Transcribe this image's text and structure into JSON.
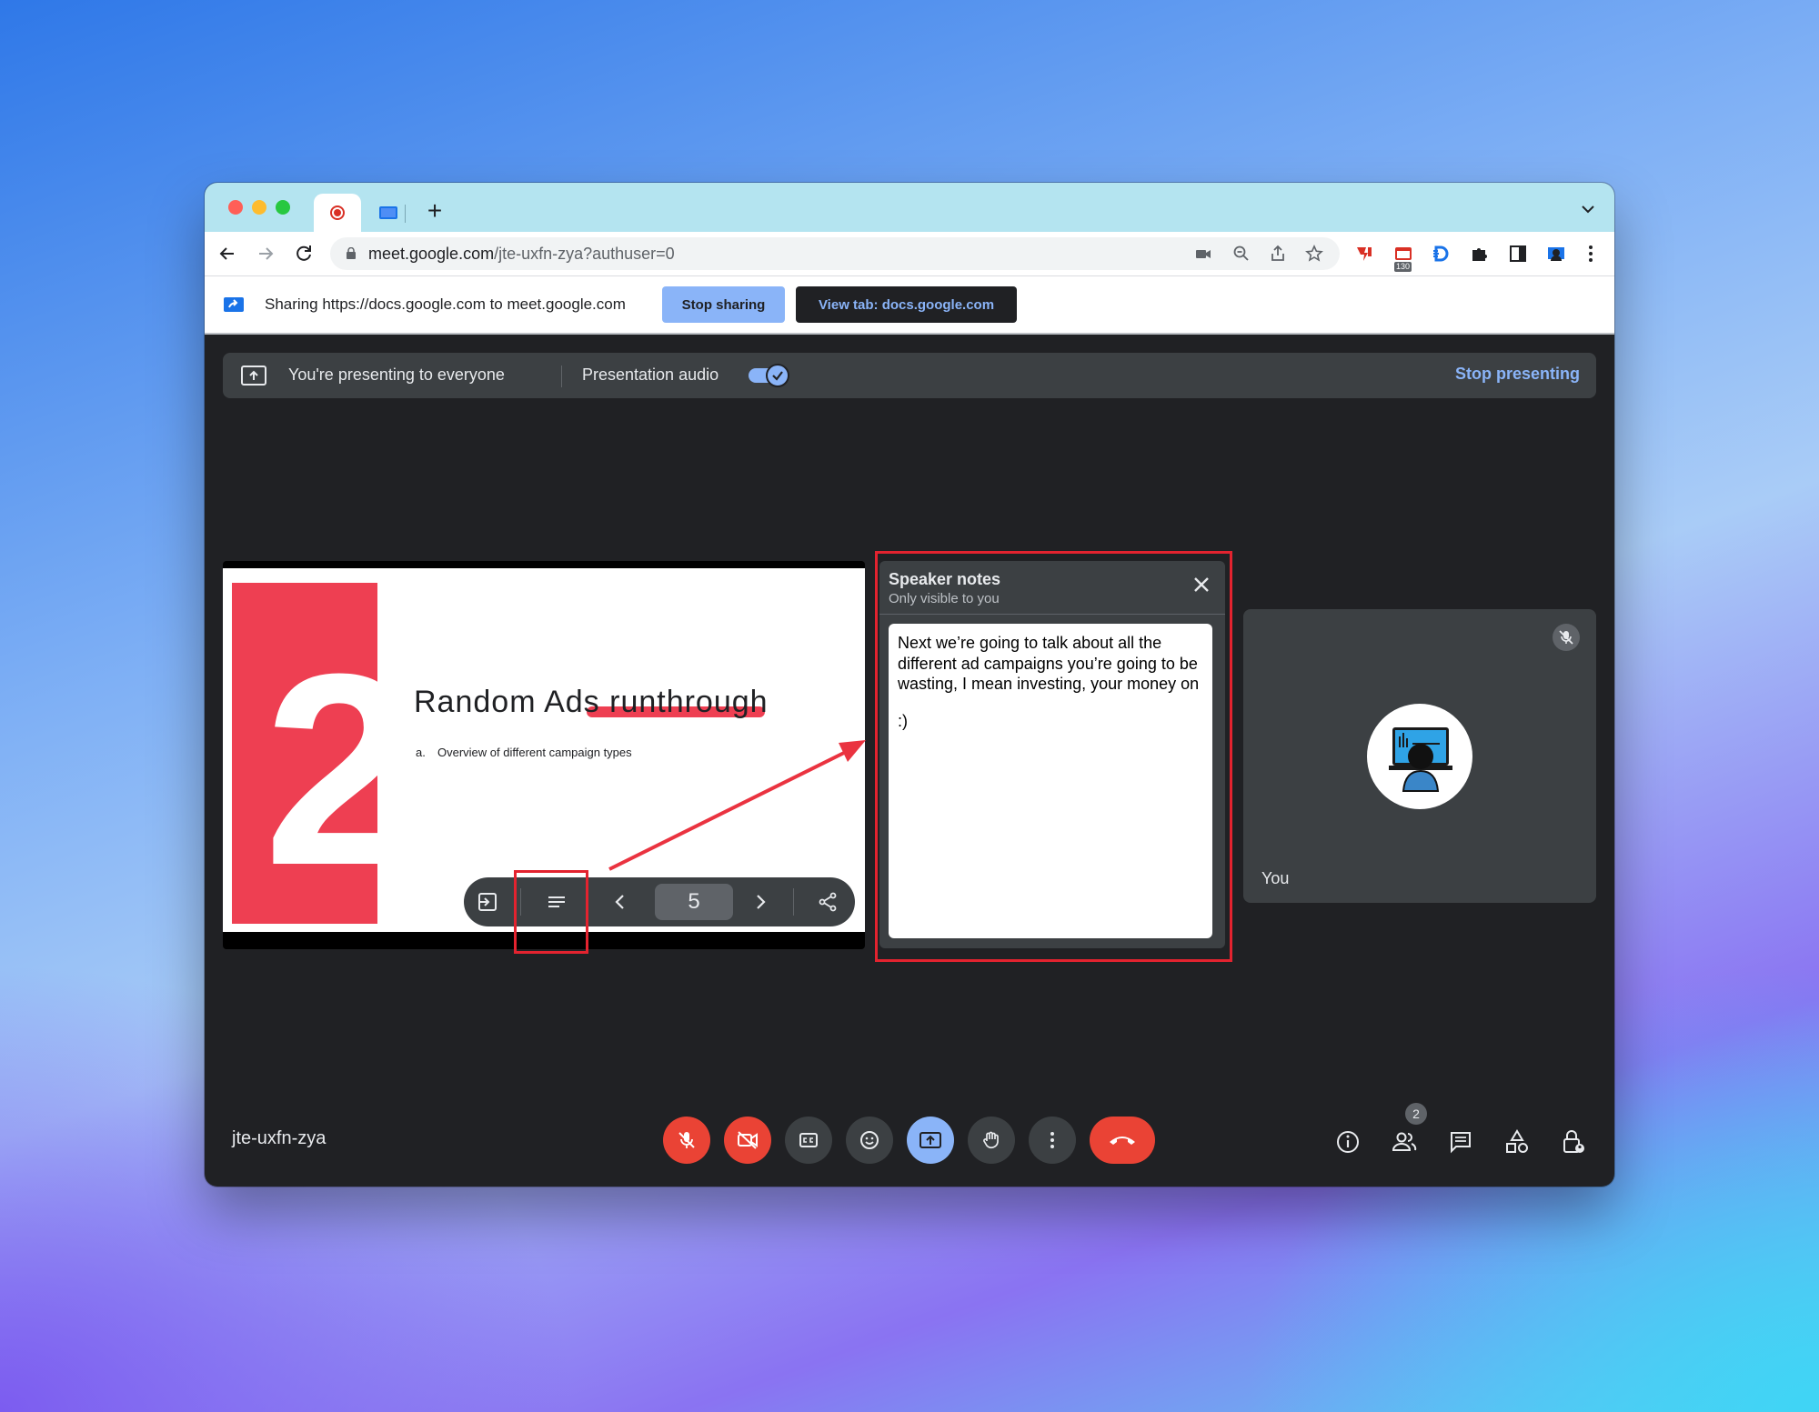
{
  "browser": {
    "tabs": [
      {
        "icon": "recording-dot-icon",
        "active": true
      },
      {
        "icon": "docs-slides-icon",
        "active": false
      }
    ],
    "url_host": "meet.google.com",
    "url_path": "/jte-uxfn-zya?authuser=0",
    "extension_badge": "130"
  },
  "share_bar": {
    "text": "Sharing https://docs.google.com to meet.google.com",
    "stop_label": "Stop sharing",
    "view_tab_label": "View tab: docs.google.com"
  },
  "present_bar": {
    "status_text": "You're presenting to everyone",
    "audio_label": "Presentation audio",
    "audio_on": true,
    "stop_label": "Stop presenting"
  },
  "slide": {
    "number_graphic": "2",
    "title": "Random Ads runthrough",
    "bullet_marker": "a.",
    "bullet_text": "Overview of different campaign types",
    "current_page": "5"
  },
  "speaker_notes": {
    "title": "Speaker notes",
    "subtitle": "Only visible to you",
    "paragraph1": "Next we’re going to talk about all the different ad campaigns you’re going to be wasting, I mean investing, your money on",
    "paragraph2": ":)"
  },
  "participant": {
    "name": "You",
    "muted": true
  },
  "meeting": {
    "code": "jte-uxfn-zya",
    "participant_count": "2"
  },
  "colors": {
    "accent_red": "#ea4335",
    "accent_blue": "#8ab4f8",
    "annotation_red": "#e3232f",
    "slide_red": "#ee3f52",
    "dark_bg": "#202124"
  }
}
